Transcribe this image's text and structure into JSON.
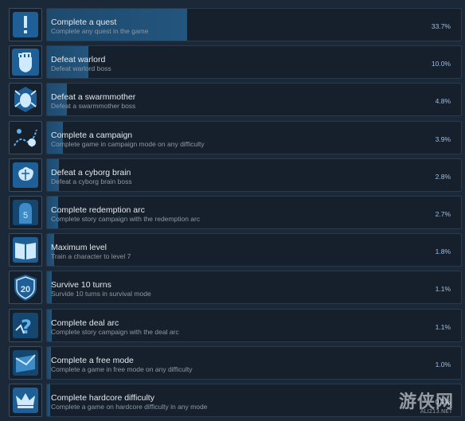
{
  "achievements": [
    {
      "title": "Complete a quest",
      "desc": "Complete any quest in the game",
      "percent": "33.7%",
      "fill_fraction": 0.337,
      "icon": "exclamation-icon"
    },
    {
      "title": "Defeat warlord",
      "desc": "Defeat warlord boss",
      "percent": "10.0%",
      "fill_fraction": 0.1,
      "icon": "fist-icon"
    },
    {
      "title": "Defeat a swarmmother",
      "desc": "Defeat a swarmmother boss",
      "percent": "4.8%",
      "fill_fraction": 0.048,
      "icon": "insect-icon"
    },
    {
      "title": "Complete a campaign",
      "desc": "Complete game in campaign mode on any difficulty",
      "percent": "3.9%",
      "fill_fraction": 0.039,
      "icon": "map-pin-icon"
    },
    {
      "title": "Defeat a cyborg brain",
      "desc": "Defeat a cyborg brain boss",
      "percent": "2.8%",
      "fill_fraction": 0.028,
      "icon": "brain-icon"
    },
    {
      "title": "Complete redemption arc",
      "desc": "Complete story campaign with the redemption arc",
      "percent": "2.7%",
      "fill_fraction": 0.027,
      "icon": "tombstone-icon"
    },
    {
      "title": "Maximum level",
      "desc": "Train a character to level 7",
      "percent": "1.8%",
      "fill_fraction": 0.018,
      "icon": "book-icon"
    },
    {
      "title": "Survive 10 turns",
      "desc": "Survide 10 turns in survival mode",
      "percent": "1.1%",
      "fill_fraction": 0.011,
      "icon": "shield-20-icon",
      "icon_text": "20"
    },
    {
      "title": "Complete deal arc",
      "desc": "Complete story campaign with the deal arc",
      "percent": "1.1%",
      "fill_fraction": 0.011,
      "icon": "question-icon"
    },
    {
      "title": "Complete a free mode",
      "desc": "Complete a game in free mode on any difficulty",
      "percent": "1.0%",
      "fill_fraction": 0.01,
      "icon": "envelope-icon"
    },
    {
      "title": "Complete hardcore difficulty",
      "desc": "Complete a game on hardcore difficulty in any mode",
      "percent": "0.7%",
      "fill_fraction": 0.007,
      "icon": "crown-icon"
    }
  ],
  "watermark": {
    "main": "游侠网",
    "sub": "ALI213.NET"
  },
  "colors": {
    "background": "#1b2838",
    "accent": "#4aa3e6",
    "fill": "#23557d"
  }
}
